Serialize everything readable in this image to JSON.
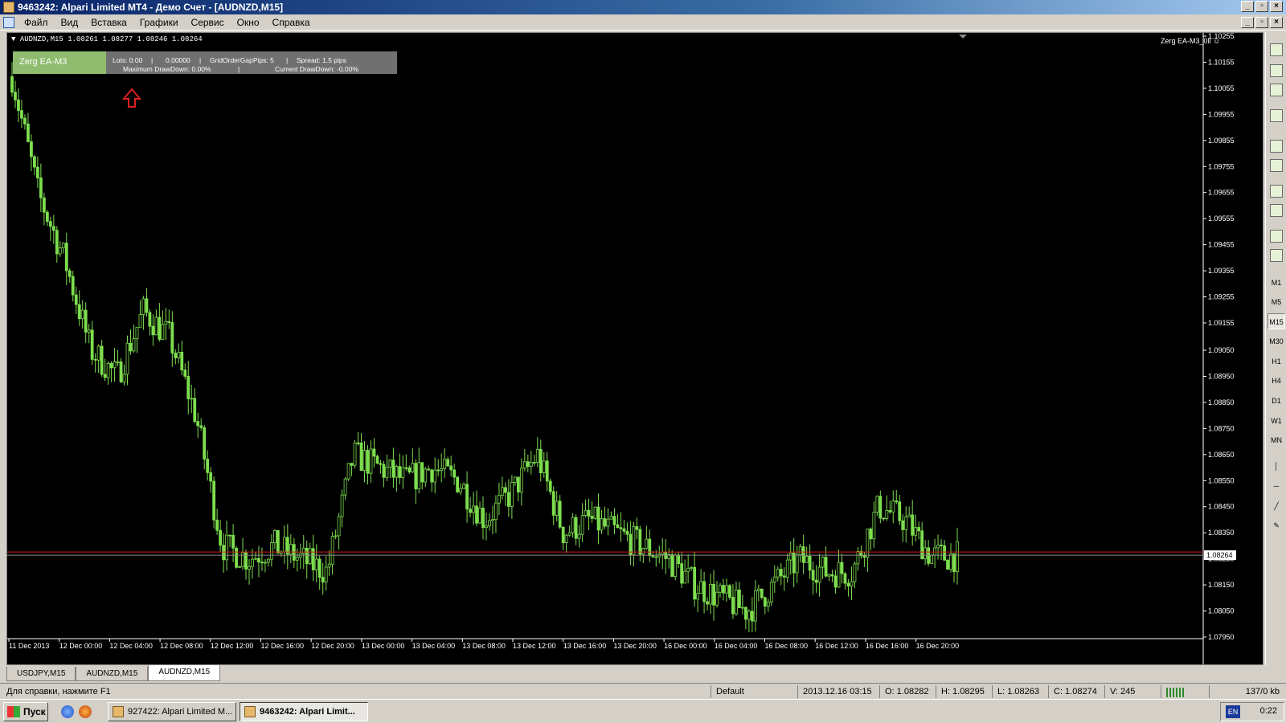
{
  "window": {
    "title": "9463242: Alpari Limited MT4 - Демо Счет - [AUDNZD,M15]"
  },
  "menu": [
    {
      "label": "Файл"
    },
    {
      "label": "Вид"
    },
    {
      "label": "Вставка"
    },
    {
      "label": "Графики"
    },
    {
      "label": "Сервис"
    },
    {
      "label": "Окно"
    },
    {
      "label": "Справка"
    }
  ],
  "chart": {
    "header": "AUDNZD,M15  1.08261 1.08277 1.08246 1.08264",
    "ea_label": "Zerg EA-M3_0ll ☺",
    "current_price": "1.08264",
    "price_labels": [
      "1.10255",
      "1.10155",
      "1.10055",
      "1.09955",
      "1.09855",
      "1.09755",
      "1.09655",
      "1.09555",
      "1.09455",
      "1.09355",
      "1.09255",
      "1.09155",
      "1.09050",
      "1.08950",
      "1.08850",
      "1.08750",
      "1.08650",
      "1.08550",
      "1.08450",
      "1.08350",
      "1.08250",
      "1.08150",
      "1.08050",
      "1.07950"
    ],
    "time_labels": [
      "11 Dec 2013",
      "12 Dec 00:00",
      "12 Dec 04:00",
      "12 Dec 08:00",
      "12 Dec 12:00",
      "12 Dec 16:00",
      "12 Dec 20:00",
      "13 Dec 00:00",
      "13 Dec 04:00",
      "13 Dec 08:00",
      "13 Dec 12:00",
      "13 Dec 16:00",
      "13 Dec 20:00",
      "16 Dec 00:00",
      "16 Dec 04:00",
      "16 Dec 08:00",
      "16 Dec 12:00",
      "16 Dec 16:00",
      "16 Dec 20:00"
    ],
    "colors": {
      "background": "#000000",
      "candle": "#7dde4e",
      "bid_line": "#d01818",
      "arrow": "#e02020"
    }
  },
  "chart_data": {
    "type": "line",
    "xlabel": "",
    "ylabel": "",
    "x": [
      "11 Dec 2013",
      "12 Dec 00:00",
      "12 Dec 02:00",
      "12 Dec 04:00",
      "12 Dec 06:00",
      "12 Dec 08:00",
      "12 Dec 10:00",
      "12 Dec 12:00",
      "12 Dec 14:00",
      "12 Dec 16:00",
      "12 Dec 18:00",
      "12 Dec 20:00",
      "12 Dec 22:00",
      "13 Dec 00:00",
      "13 Dec 02:00",
      "13 Dec 04:00",
      "13 Dec 06:00",
      "13 Dec 08:00",
      "13 Dec 10:00",
      "13 Dec 12:00",
      "13 Dec 14:00",
      "13 Dec 16:00",
      "13 Dec 18:00",
      "13 Dec 20:00",
      "13 Dec 22:00",
      "16 Dec 00:00",
      "16 Dec 02:00",
      "16 Dec 04:00",
      "16 Dec 06:00",
      "16 Dec 08:00",
      "16 Dec 10:00",
      "16 Dec 12:00",
      "16 Dec 14:00",
      "16 Dec 16:00",
      "16 Dec 18:00",
      "16 Dec 20:00",
      "16 Dec 22:00"
    ],
    "series": [
      {
        "values": [
          1.101,
          1.0965,
          1.094,
          1.0905,
          1.0895,
          1.092,
          1.091,
          1.088,
          1.083,
          1.0825,
          1.083,
          1.0825,
          1.082,
          1.0865,
          1.086,
          1.0855,
          1.086,
          1.0855,
          1.084,
          1.085,
          1.0865,
          1.0835,
          1.084,
          1.0835,
          1.083,
          1.0825,
          1.0815,
          1.081,
          1.0805,
          1.0815,
          1.0825,
          1.082,
          1.082,
          1.0845,
          1.084,
          1.0826,
          1.0826
        ]
      }
    ],
    "ylim": [
      1.0795,
      1.10255
    ],
    "grid": false
  },
  "ea_panel": {
    "name": "Zerg EA-M3",
    "lots": "Lots: 0.00",
    "sep": "|",
    "value": "0.00000",
    "grid_gap": "GridOrderGapPips: 5",
    "spread": "Spread: 1.5 pips",
    "max_dd": "Maximum DrawDown: 0.00%",
    "cur_dd": "Current DrawDown: -0.00%"
  },
  "timeframes": [
    "M1",
    "M5",
    "M15",
    "M30",
    "H1",
    "H4",
    "D1",
    "W1",
    "MN"
  ],
  "active_timeframe": "M15",
  "tabs": [
    {
      "label": "USDJPY,M15"
    },
    {
      "label": "AUDNZD,M15"
    },
    {
      "label": "AUDNZD,M15"
    }
  ],
  "status": {
    "help": "Для справки, нажмите F1",
    "profile": "Default",
    "time": "2013.12.16 03:15",
    "open": "O: 1.08282",
    "high": "H: 1.08295",
    "low": "L: 1.08263",
    "close": "C: 1.08274",
    "volume": "V: 245",
    "traffic": "137/0 kb"
  },
  "taskbar": {
    "start": "Пуск",
    "task1": "927422: Alpari Limited M...",
    "task2": "9463242: Alpari Limit...",
    "lang": "EN",
    "clock": "0:22"
  }
}
